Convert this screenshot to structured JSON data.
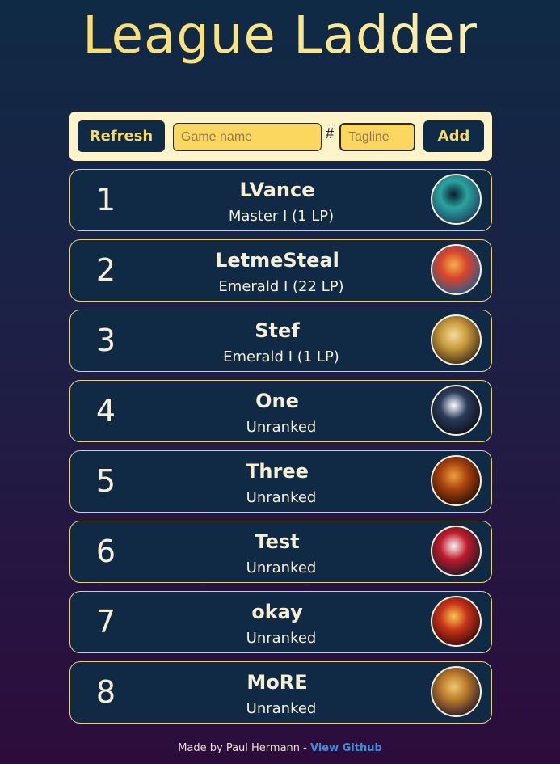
{
  "header": {
    "title": "League Ladder"
  },
  "controls": {
    "refresh_label": "Refresh",
    "game_name_placeholder": "Game name",
    "hash_separator": "#",
    "tagline_placeholder": "Tagline",
    "add_label": "Add"
  },
  "players": [
    {
      "rank": "1",
      "name": "LVance",
      "tier": "Master I (1 LP)",
      "icon": "champion-icon-hooded-mage",
      "colors": [
        "#1d3f5e",
        "#2aa4a0",
        "#0c1a2a"
      ]
    },
    {
      "rank": "2",
      "name": "LetmeSteal",
      "tier": "Emerald I (22 LP)",
      "icon": "champion-icon-red-bird",
      "colors": [
        "#2b5a8a",
        "#d9432a",
        "#f0b34a"
      ]
    },
    {
      "rank": "3",
      "name": "Stef",
      "tier": "Emerald I (1 LP)",
      "icon": "champion-icon-golden-knight",
      "colors": [
        "#3a2a16",
        "#c99a3a",
        "#f2dca0"
      ]
    },
    {
      "rank": "4",
      "name": "One",
      "tier": "Unranked",
      "icon": "champions-emblem-icon",
      "colors": [
        "#0d0f16",
        "#2a3a5a",
        "#ffffff"
      ]
    },
    {
      "rank": "5",
      "name": "Three",
      "tier": "Unranked",
      "icon": "champion-icon-fire-beast",
      "colors": [
        "#2a0e05",
        "#a8420e",
        "#f0a03a"
      ]
    },
    {
      "rank": "6",
      "name": "Test",
      "tier": "Unranked",
      "icon": "champion-icon-red-eye",
      "colors": [
        "#1a1a2a",
        "#c01a2a",
        "#f5f5f5"
      ]
    },
    {
      "rank": "7",
      "name": "okay",
      "tier": "Unranked",
      "icon": "champion-icon-flame-dragon",
      "colors": [
        "#3a0a0a",
        "#c8321a",
        "#f5c84a"
      ]
    },
    {
      "rank": "8",
      "name": "MoRE",
      "tier": "Unranked",
      "icon": "champion-icon-golden-fist",
      "colors": [
        "#2a1a2a",
        "#b8782a",
        "#f0c870"
      ]
    }
  ],
  "footer": {
    "credit": "Made by Paul Hermann - ",
    "link_label": "View Github"
  }
}
